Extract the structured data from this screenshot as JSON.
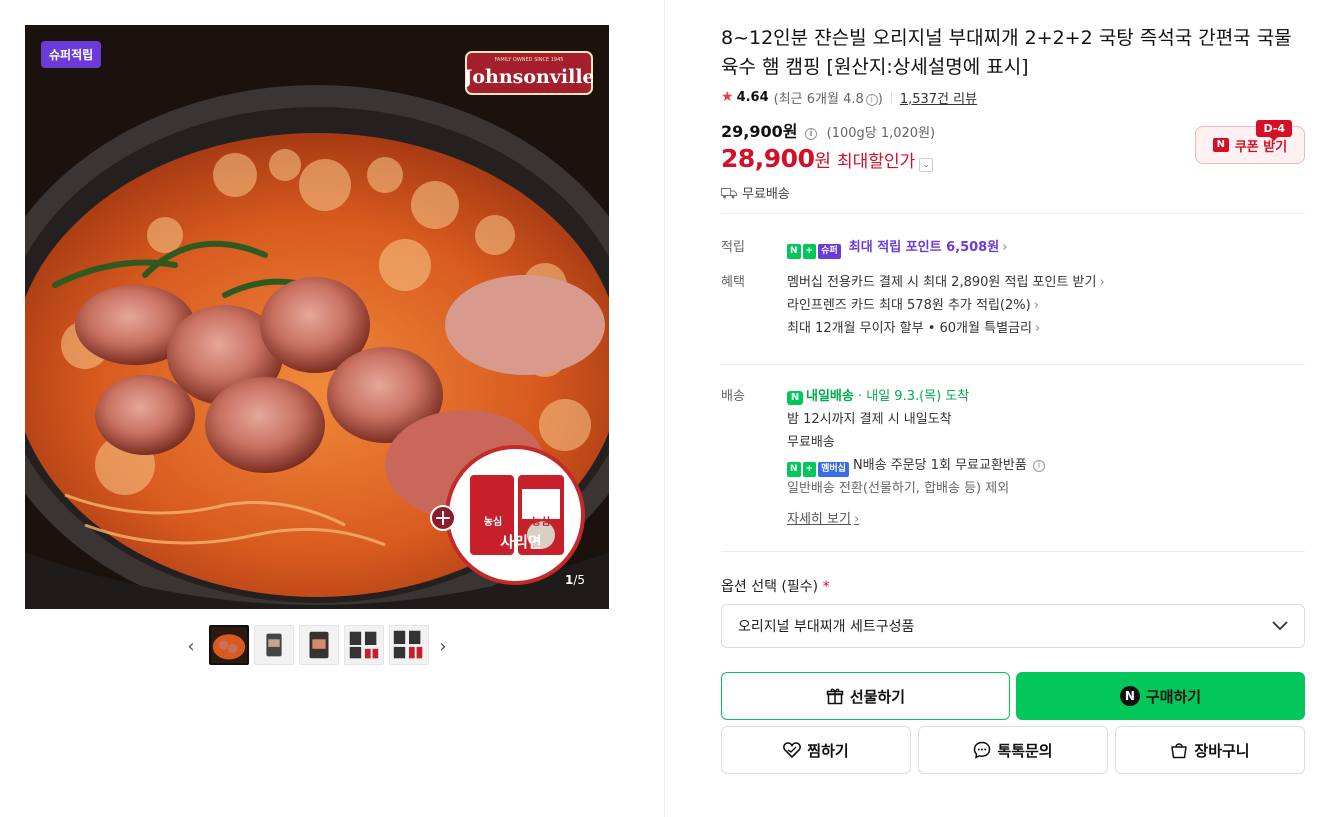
{
  "gallery": {
    "badge": "슈퍼적립",
    "brand": "Johnsonville",
    "brand_tagline": "FAMILY OWNED SINCE 1945",
    "addon_text_1": "농심",
    "addon_text_2": "사리면",
    "counter_current": "1",
    "counter_total": "/5",
    "thumbnail_count": 5
  },
  "product": {
    "title": "8~12인분 쟌슨빌 오리지널 부대찌개 2+2+2 국탕 즉석국 간편국 국물 육수 햄 캠핑 [원산지:상세설명에 표시]",
    "rating": "4.64",
    "rating_recent": "(최근 6개월 4.8",
    "rating_recent_close": ")",
    "reviews": "1,537건 리뷰"
  },
  "price": {
    "original": "29,900원",
    "unit_note": "(100g당 1,020원)",
    "sale": "28,900",
    "sale_unit": "원",
    "sale_label": "최대할인가",
    "free_shipping": "무료배송"
  },
  "coupon": {
    "label": "쿠폰 받기",
    "dday": "D-4",
    "n": "N"
  },
  "points": {
    "label": "적립",
    "tag_n": "N",
    "tag_plus": "+",
    "tag_super": "슈퍼",
    "text": "최대 적립 포인트 6,508원"
  },
  "benefits": {
    "label": "혜택",
    "items": [
      "멤버십 전용카드 결제 시 최대 2,890원 적립 포인트 받기",
      "라인프렌즈 카드 최대 578원 추가 적립(2%)",
      "최대 12개월 무이자 할부 • 60개월 특별금리"
    ]
  },
  "delivery": {
    "label": "배송",
    "tag": "내일배송",
    "date": "· 내일 9.3.(목) 도착",
    "line1": "밤 12시까지 결제 시 내일도착",
    "line2": "무료배송",
    "membership_tag": "멤버십",
    "line3": "N배송 주문당 1회 무료교환반품",
    "line4": "일반배송 전환(선물하기, 합배송 등) 제외",
    "detail_link": "자세히 보기"
  },
  "option": {
    "label": "옵션 선택 (필수)",
    "required_mark": "*",
    "selected": "오리지널 부대찌개 세트구성품"
  },
  "buttons": {
    "gift": "선물하기",
    "buy": "구매하기",
    "wish": "찜하기",
    "talk": "톡톡문의",
    "cart": "장바구니"
  },
  "colors": {
    "accent_green": "#03c75a",
    "sale_red": "#d60e26",
    "super_purple": "#6a3bd9"
  }
}
